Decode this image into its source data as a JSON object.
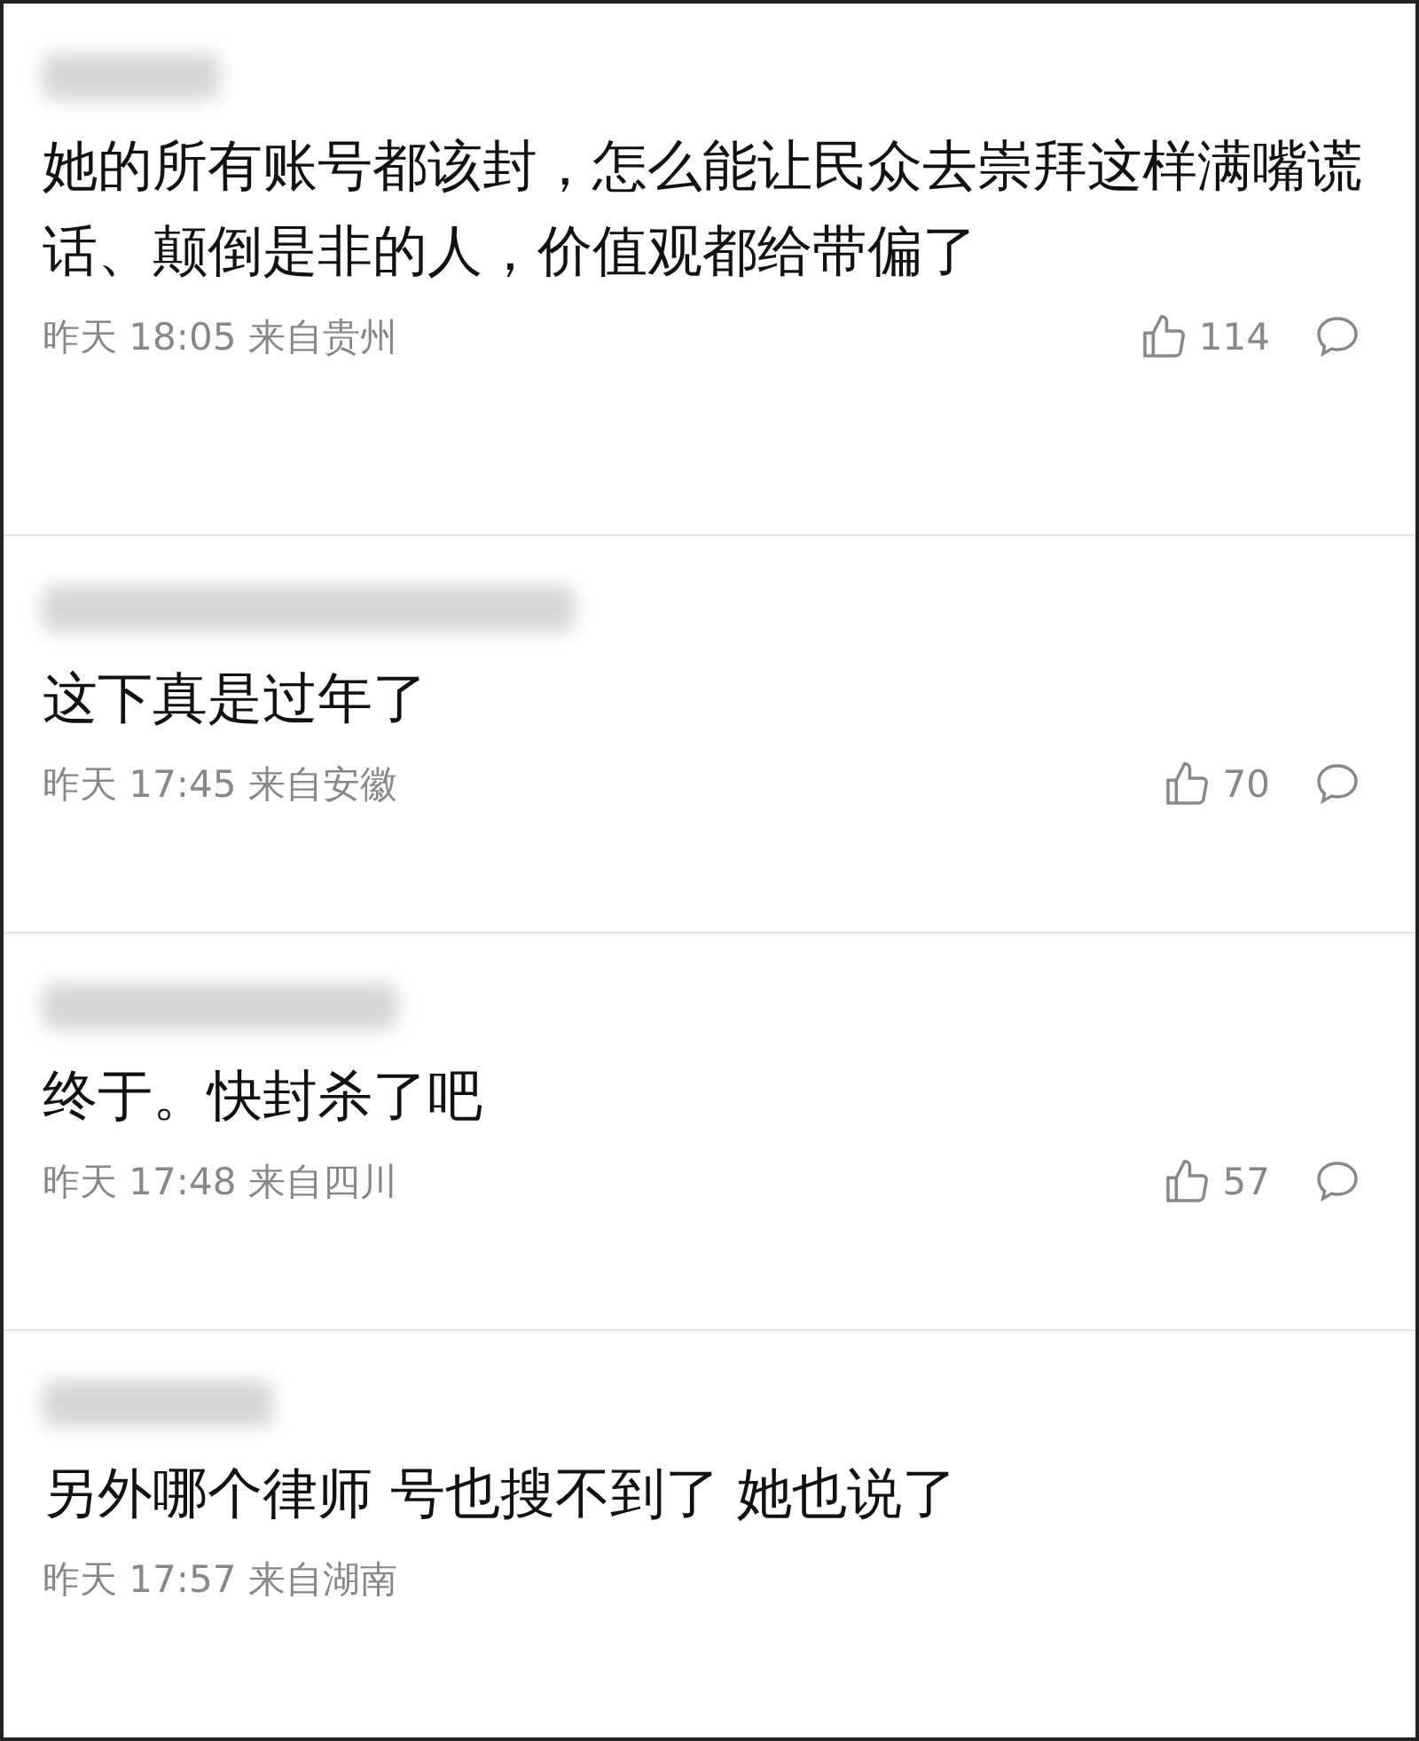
{
  "comments": [
    {
      "text": "她的所有账号都该封，怎么能让民众去崇拜这样满嘴谎话、颠倒是非的人，价值观都给带偏了",
      "time": "昨天 18:05 来自贵州",
      "likes": "114"
    },
    {
      "text": "这下真是过年了",
      "time": "昨天 17:45 来自安徽",
      "likes": "70"
    },
    {
      "text": "终于。快封杀了吧",
      "time": "昨天 17:48 来自四川",
      "likes": "57"
    },
    {
      "text": "另外哪个律师 号也搜不到了 她也说了",
      "time": "昨天 17:57 来自湖南"
    }
  ]
}
